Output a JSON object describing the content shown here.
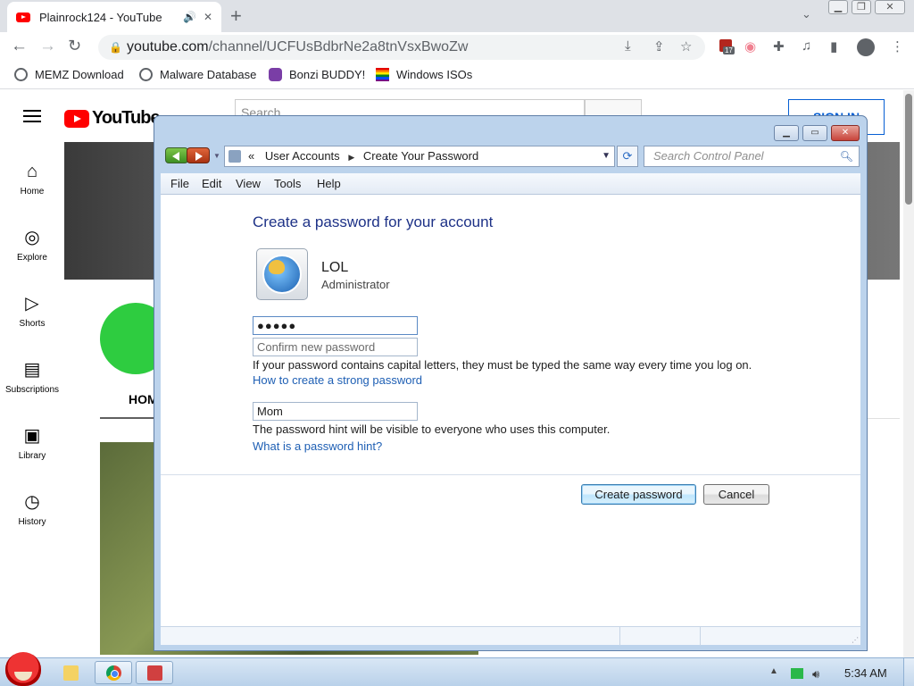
{
  "browser": {
    "tab_title": "Plainrock124 - YouTube",
    "url_host": "youtube.com",
    "url_path": "/channel/UCFUsBdbrNe2a8tnVsxBwoZw",
    "ext_badge_count": "17",
    "bookmarks": [
      {
        "label": "MEMZ Download",
        "icon": "globe-icon"
      },
      {
        "label": "Malware Database",
        "icon": "globe-icon"
      },
      {
        "label": "Bonzi BUDDY!",
        "icon": "bonzi-icon"
      },
      {
        "label": "Windows ISOs",
        "icon": "rainbow-icon"
      }
    ]
  },
  "youtube": {
    "logo_text": "YouTube",
    "search_placeholder": "Search",
    "signin_label": "SIGN IN",
    "guide": [
      {
        "label": "Home",
        "icon": "home-icon"
      },
      {
        "label": "Explore",
        "icon": "compass-icon"
      },
      {
        "label": "Shorts",
        "icon": "shorts-icon"
      },
      {
        "label": "Subscriptions",
        "icon": "subscriptions-icon"
      },
      {
        "label": "Library",
        "icon": "library-icon"
      },
      {
        "label": "History",
        "icon": "history-icon"
      }
    ],
    "home_tab": "HOME"
  },
  "control_panel": {
    "breadcrumb_prefix": "«",
    "breadcrumb": [
      "User Accounts",
      "Create Your Password"
    ],
    "search_placeholder": "Search Control Panel",
    "menu": [
      "File",
      "Edit",
      "View",
      "Tools",
      "Help"
    ],
    "heading": "Create a password for your account",
    "account_name": "LOL",
    "account_role": "Administrator",
    "password_value": "●●●●●",
    "confirm_placeholder": "Confirm new password",
    "capital_note": "If your password contains capital letters, they must be typed the same way every time you log on.",
    "strong_link": "How to create a strong password",
    "hint_value": "Mom",
    "hint_note": "The password hint will be visible to everyone who uses this computer.",
    "hint_link": "What is a password hint?",
    "create_button": "Create password",
    "cancel_button": "Cancel"
  },
  "taskbar": {
    "clock": "5:34 AM"
  }
}
